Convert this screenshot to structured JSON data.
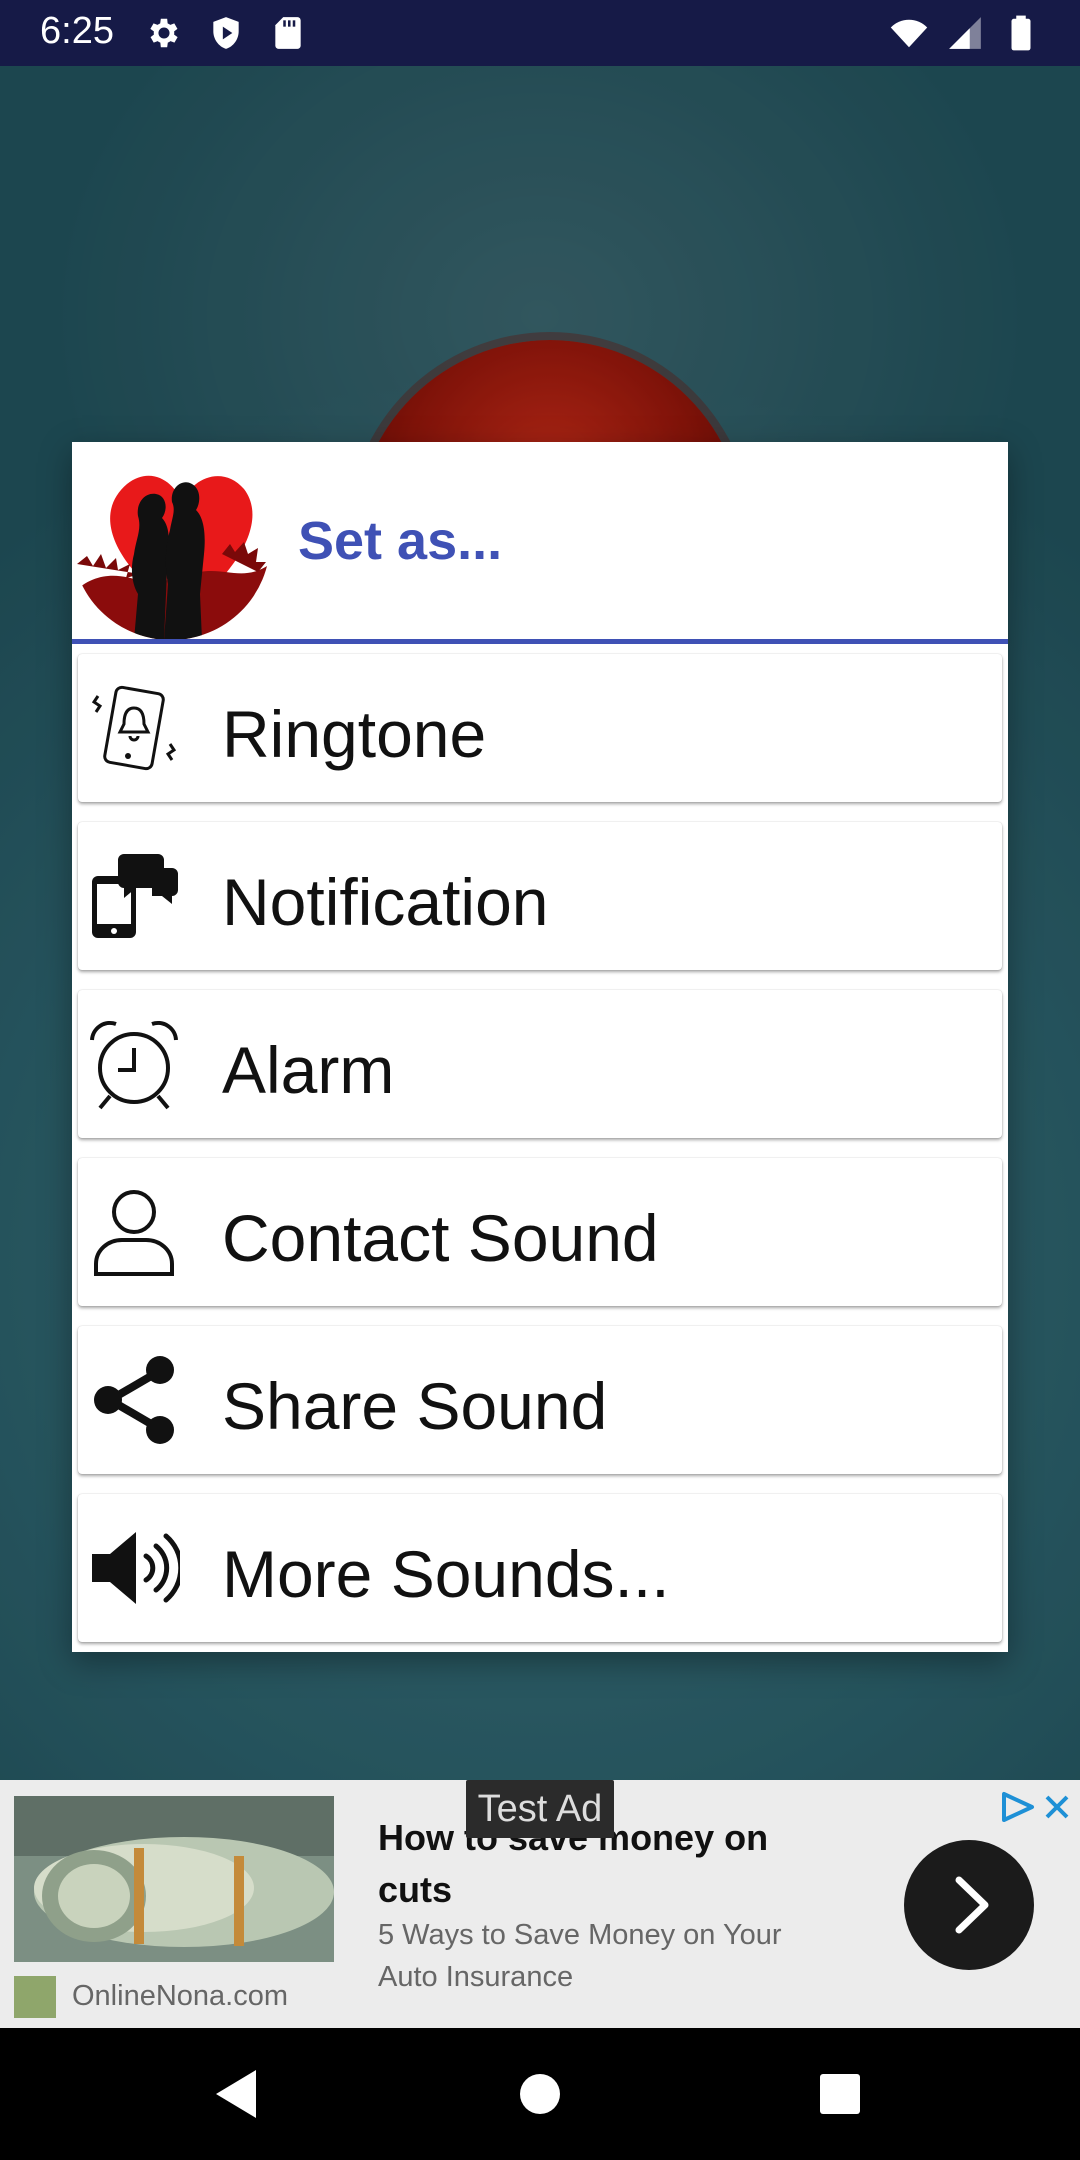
{
  "status_bar": {
    "time": "6:25",
    "left_icons": [
      "settings-icon",
      "shield-icon",
      "sd-card-icon"
    ],
    "right_icons": [
      "wifi-icon",
      "cell-signal-icon",
      "battery-icon"
    ]
  },
  "dialog": {
    "title": "Set as...",
    "header_image": "couple-heart-image",
    "accent_color": "#3f51b5",
    "items": [
      {
        "label": "Ringtone",
        "icon": "ringing-phone-icon"
      },
      {
        "label": "Notification",
        "icon": "phone-chat-icon"
      },
      {
        "label": "Alarm",
        "icon": "alarm-clock-icon"
      },
      {
        "label": "Contact Sound",
        "icon": "person-icon"
      },
      {
        "label": "Share Sound",
        "icon": "share-icon"
      },
      {
        "label": "More Sounds...",
        "icon": "speaker-icon"
      }
    ]
  },
  "ad": {
    "badge": "Test Ad",
    "headline": "How to save money on cuts",
    "body": "5 Ways to Save Money on Your Auto Insurance",
    "source": "OnlineNona.com"
  },
  "nav_bar": {
    "buttons": [
      "back-button",
      "home-button",
      "recents-button"
    ]
  }
}
